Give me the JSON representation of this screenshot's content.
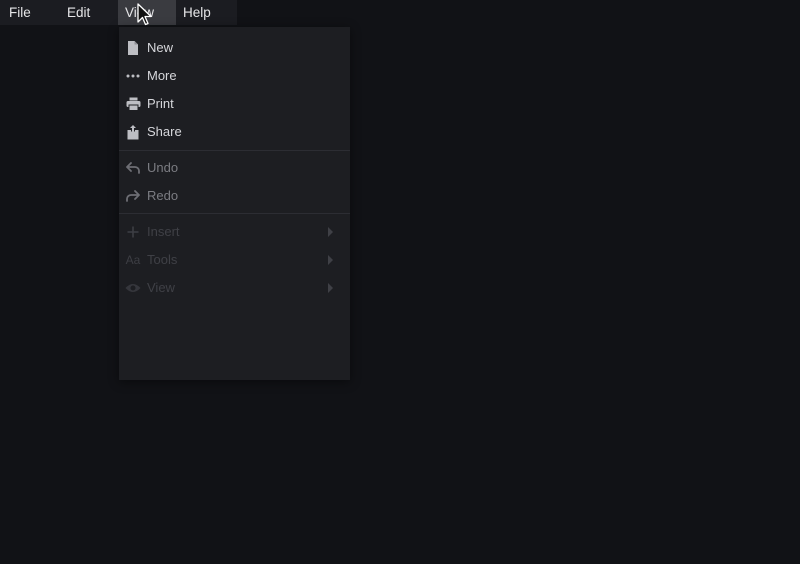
{
  "menubar": {
    "items": [
      {
        "label": "File"
      },
      {
        "label": "Edit"
      },
      {
        "label": "View"
      },
      {
        "label": "Help"
      }
    ]
  },
  "dropdown": {
    "items": [
      {
        "label": "New",
        "icon": "document-icon",
        "state": "enabled"
      },
      {
        "label": "More",
        "icon": "ellipsis-icon",
        "state": "enabled"
      },
      {
        "label": "Print",
        "icon": "printer-icon",
        "state": "enabled"
      },
      {
        "label": "Share",
        "icon": "share-icon",
        "state": "enabled"
      },
      {
        "label": "Undo",
        "icon": "undo-icon",
        "state": "disabled"
      },
      {
        "label": "Redo",
        "icon": "redo-icon",
        "state": "disabled"
      },
      {
        "label": "Insert",
        "icon": "plus-icon",
        "state": "faded",
        "submenu": true
      },
      {
        "label": "Tools",
        "icon": "text-format-icon",
        "state": "faded",
        "submenu": true
      },
      {
        "label": "View",
        "icon": "eye-icon",
        "state": "faded",
        "submenu": true
      }
    ]
  },
  "colors": {
    "background": "#111216",
    "menubar": "#1b1c21",
    "menubar_active": "#3a3b40",
    "dropdown": "#1d1e22",
    "text_primary": "#e6e6e8",
    "text_enabled": "#d6d7db",
    "text_disabled": "#7b7c82",
    "text_faded": "#3f4046"
  }
}
